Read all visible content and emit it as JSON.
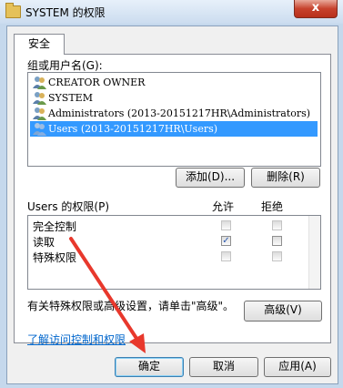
{
  "window": {
    "title": "SYSTEM 的权限",
    "close_glyph": "x"
  },
  "tabs": [
    {
      "label": "安全"
    }
  ],
  "group_section": {
    "label": "组或用户名(G):",
    "users": [
      {
        "name": "CREATOR OWNER",
        "selected": false
      },
      {
        "name": "SYSTEM",
        "selected": false
      },
      {
        "name": "Administrators (2013-20151217HR\\Administrators)",
        "selected": false
      },
      {
        "name": "Users (2013-20151217HR\\Users)",
        "selected": true
      }
    ],
    "add_button": "添加(D)...",
    "remove_button": "删除(R)"
  },
  "permissions": {
    "header_label": "Users 的权限(P)",
    "allow_header": "允许",
    "deny_header": "拒绝",
    "rows": [
      {
        "name": "完全控制",
        "allow": false,
        "deny": false
      },
      {
        "name": "读取",
        "allow": true,
        "deny": false
      },
      {
        "name": "特殊权限",
        "allow": false,
        "deny": false
      }
    ]
  },
  "advanced": {
    "description": "有关特殊权限或高级设置，请单击\"高级\"。",
    "button": "高级(V)"
  },
  "help_link": "了解访问控制和权限",
  "footer": {
    "ok": "确定",
    "cancel": "取消",
    "apply": "应用(A)"
  },
  "colors": {
    "selection": "#3399ff",
    "link": "#0066cc",
    "annotation_arrow": "#e8382c"
  }
}
